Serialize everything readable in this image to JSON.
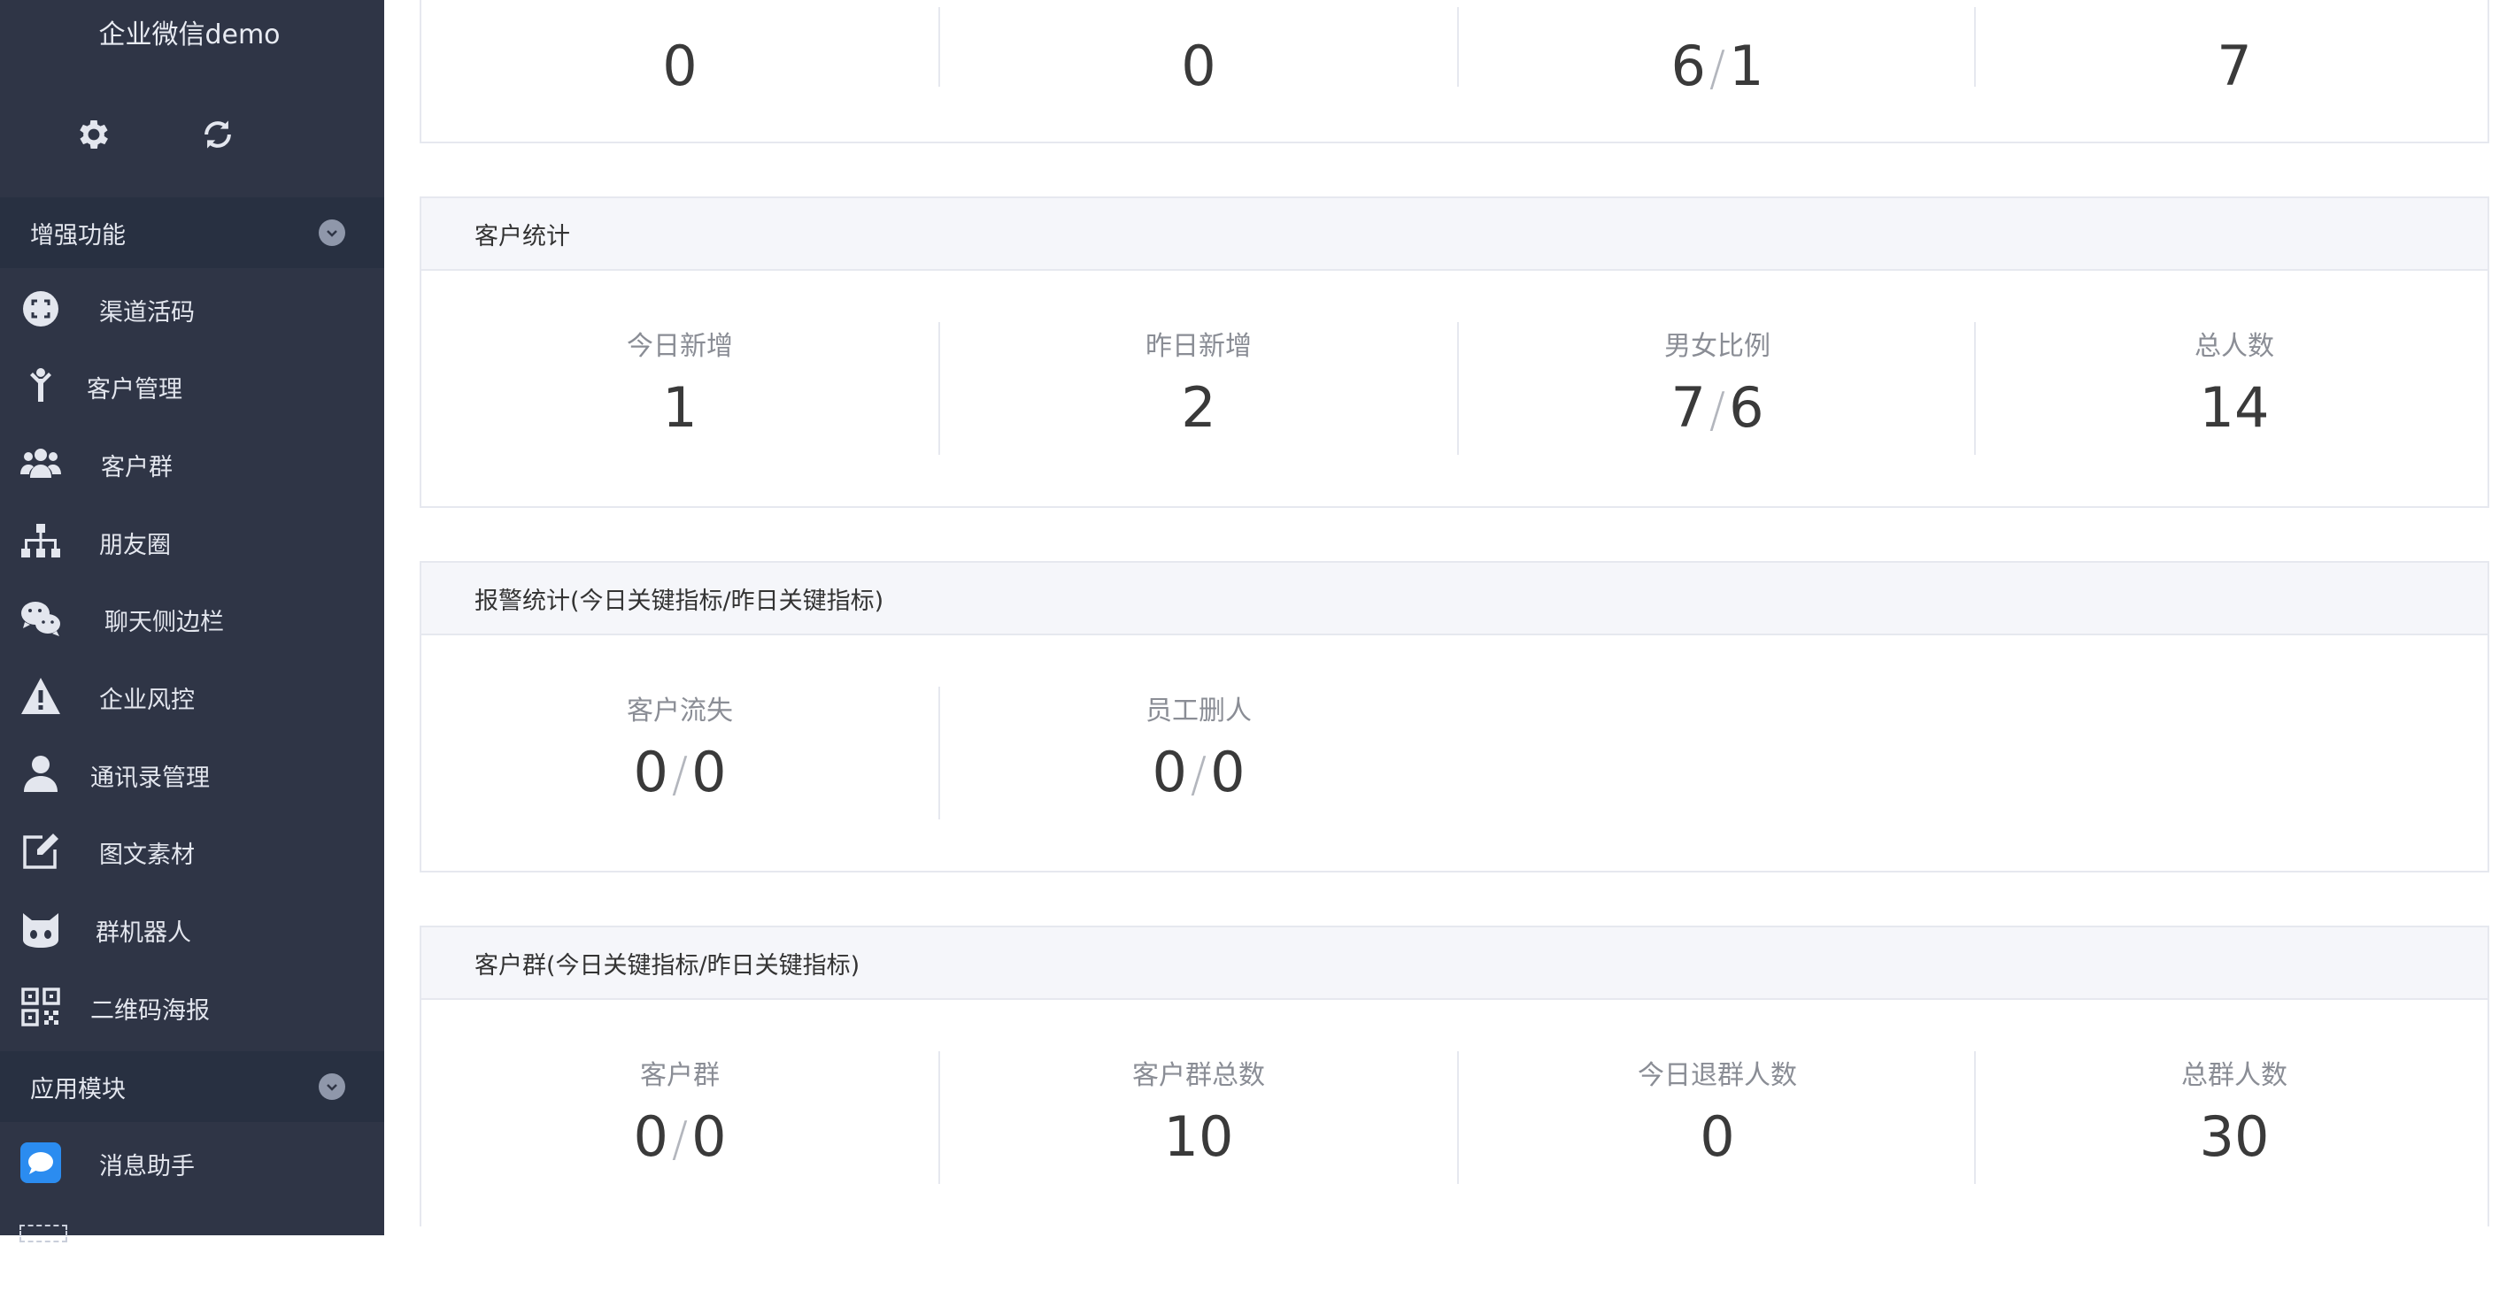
{
  "sidebar": {
    "app_title": "企业微信demo",
    "top_icons": [
      "gear-icon",
      "refresh-icon"
    ],
    "sections": [
      {
        "label": "增强功能"
      },
      {
        "label": "应用模块"
      }
    ],
    "items": [
      {
        "label": "渠道活码",
        "icon": "qrcode-scan-icon"
      },
      {
        "label": "客户管理",
        "icon": "person-icon"
      },
      {
        "label": "客户群",
        "icon": "users-icon"
      },
      {
        "label": "朋友圈",
        "icon": "sitemap-icon"
      },
      {
        "label": "聊天侧边栏",
        "icon": "wechat-icon"
      },
      {
        "label": "企业风控",
        "icon": "warning-icon"
      },
      {
        "label": "通讯录管理",
        "icon": "user-icon"
      },
      {
        "label": "图文素材",
        "icon": "edit-icon"
      },
      {
        "label": "群机器人",
        "icon": "robot-icon"
      },
      {
        "label": "二维码海报",
        "icon": "qrcode-icon"
      },
      {
        "label": "消息助手",
        "icon": "chat-bubble-icon"
      }
    ],
    "accent": "#2f3546"
  },
  "top_panel": {
    "values": [
      {
        "a": "0"
      },
      {
        "a": "0"
      },
      {
        "a": "6",
        "b": "1"
      },
      {
        "a": "7"
      }
    ]
  },
  "customer_stats": {
    "title": "客户统计",
    "stats": [
      {
        "label": "今日新增",
        "a": "1"
      },
      {
        "label": "昨日新增",
        "a": "2"
      },
      {
        "label": "男女比例",
        "a": "7",
        "b": "6"
      },
      {
        "label": "总人数",
        "a": "14"
      }
    ]
  },
  "alert_stats": {
    "title": "报警统计(今日关键指标/昨日关键指标)",
    "stats": [
      {
        "label": "客户流失",
        "a": "0",
        "b": "0"
      },
      {
        "label": "员工删人",
        "a": "0",
        "b": "0"
      }
    ]
  },
  "group_stats": {
    "title": "客户群(今日关键指标/昨日关键指标)",
    "stats": [
      {
        "label": "客户群",
        "a": "0",
        "b": "0"
      },
      {
        "label": "客户群总数",
        "a": "10"
      },
      {
        "label": "今日退群人数",
        "a": "0"
      },
      {
        "label": "总群人数",
        "a": "30"
      }
    ]
  },
  "separator": "/"
}
